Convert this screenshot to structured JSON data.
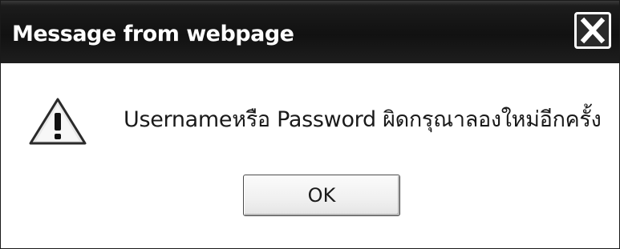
{
  "dialog": {
    "title": "Message from webpage",
    "message": "Usernameหรือ Password ผิดกรุณาลองใหม่อีกครั้ง",
    "ok_label": "OK"
  },
  "icons": {
    "close": "close-icon",
    "warning": "warning-icon"
  },
  "colors": {
    "titlebar": "#111111",
    "title_text": "#ffffff",
    "body": "#ffffff",
    "message_text": "#1a1a1a"
  }
}
